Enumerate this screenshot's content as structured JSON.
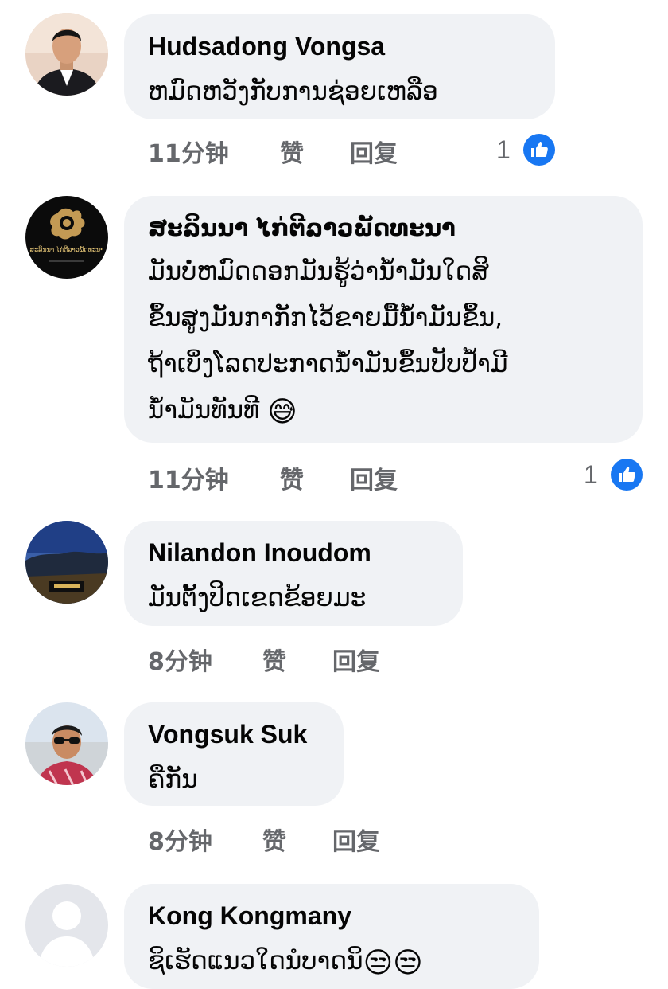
{
  "comments": [
    {
      "author": "Hudsadong Vongsa",
      "text": "ຫມົດຫວັງກັບການຊ່ອຍເຫລືອ",
      "time": "11分钟",
      "like_label": "赞",
      "reply_label": "回复",
      "reaction_count": "1",
      "reaction_icon": "like-icon",
      "avatar": "man-in-suit-avatar"
    },
    {
      "author": "ສະລິນນາ ໄກ່ຕີລາວພັດທະນາ",
      "text": "ມັນບໍ່ຫມົດດອກມັນຮູ້ວ່ານໍ້າມັນໃດສິ\nຂຶ້ນສູງມັນກາກັກໄວ້ຂາຍມື້ນໍ້າມັນຂຶ້ນ,\nຖ້າເບິ່ງໂລດປະກາດນໍ້າມັນຂຶ້ນປັບປໍ້າມີ\nນໍ້າມັນທັນທີ",
      "emoji": "😅",
      "time": "11分钟",
      "like_label": "赞",
      "reply_label": "回复",
      "reaction_count": "1",
      "reaction_icon": "like-icon",
      "avatar": "rooster-logo-avatar",
      "avatar_text": "ສະລິນນາ ໄກ່ຕີລາວພັດທະນາ"
    },
    {
      "author": "Nilandon Inoudom",
      "text": "ມັນຕັ້ງປິດເຂດຂ້ອຍມະ",
      "time": "8分钟",
      "like_label": "赞",
      "reply_label": "回复",
      "avatar": "landscape-avatar"
    },
    {
      "author": "Vongsuk Suk",
      "text": "ຄືກັນ",
      "time": "8分钟",
      "like_label": "赞",
      "reply_label": "回复",
      "avatar": "man-sunglasses-avatar"
    },
    {
      "author": "Kong Kongmany",
      "text": "ຊິເຮັດແນວໃດນໍບາດນິ",
      "emoji": "😒😒",
      "avatar": "default-profile-avatar"
    }
  ],
  "colors": {
    "bubble": "#f0f2f5",
    "meta_text": "#65676b",
    "like_blue": "#1877f2"
  }
}
